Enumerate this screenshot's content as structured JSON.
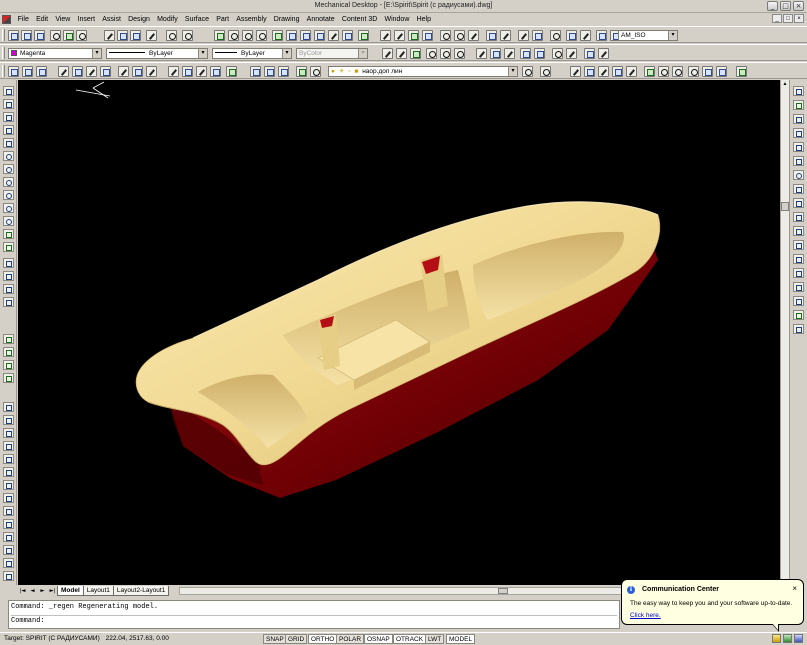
{
  "window": {
    "title": "Mechanical Desktop - [E:\\Spirit\\Spirit (с радиусами).dwg]",
    "buttons": {
      "minimize": "_",
      "maximize": "□",
      "close": "×"
    }
  },
  "menu": {
    "items": [
      "File",
      "Edit",
      "View",
      "Insert",
      "Assist",
      "Design",
      "Modify",
      "Surface",
      "Part",
      "Assembly",
      "Drawing",
      "Annotate",
      "Content 3D",
      "Window",
      "Help"
    ]
  },
  "properties_bar": {
    "color": "Magenta",
    "linetype": "ByLayer",
    "lineweight": "ByLayer",
    "plotstyle": "ByColor",
    "dimstyle": "AM_ISO"
  },
  "layer_bar": {
    "layer": "наор.доп лин"
  },
  "layout_tabs": {
    "nav": [
      "|◄",
      "◄",
      "►",
      "►|"
    ],
    "tabs": [
      "Model",
      "Layout1",
      "Layout2-Layout1"
    ],
    "active": "Model"
  },
  "command": {
    "history": "Command: _regen Regenerating model.",
    "prompt": "Command:"
  },
  "status": {
    "target": "Target: SPIRIT (С РАДИУСАМИ)",
    "coords": "222.04, 2517.63, 0.00",
    "toggles": [
      "SNAP",
      "GRID",
      "ORTHO",
      "POLAR",
      "OSNAP",
      "OTRACK",
      "LWT",
      "MODEL"
    ]
  },
  "balloon": {
    "title": "Communication Center",
    "message": "The easy way to keep you and your software up-to-date.",
    "link": "Click here.",
    "close": "×",
    "info": "i"
  },
  "colors": {
    "viewport_bg": "#000000",
    "boat_deck": "#f1d993",
    "boat_hull": "#8b0000",
    "accent_red": "#b40f14"
  }
}
